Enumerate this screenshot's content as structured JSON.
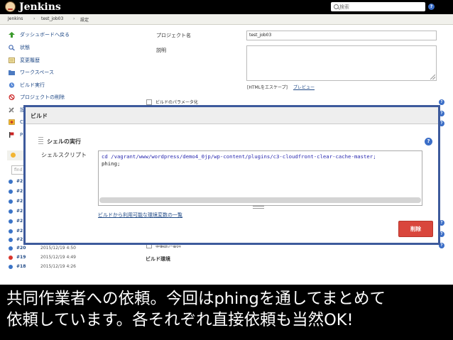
{
  "header": {
    "logo_text": "Jenkins",
    "search_placeholder": "検索",
    "help_label": "?"
  },
  "breadcrumb": [
    "Jenkins",
    "test_job03",
    "設定"
  ],
  "breadcrumb_separator": "›",
  "sidebar": {
    "items": [
      {
        "label": "ダッシュボードへ戻る",
        "icon": "up-arrow-icon"
      },
      {
        "label": "状態",
        "icon": "magnifier-icon"
      },
      {
        "label": "変更履歴",
        "icon": "notepad-icon"
      },
      {
        "label": "ワークスペース",
        "icon": "folder-icon"
      },
      {
        "label": "ビルド実行",
        "icon": "clock-icon"
      },
      {
        "label": "プロジェクトの削除",
        "icon": "no-entry-icon"
      }
    ],
    "partial_items": [
      "設",
      "C",
      "P"
    ],
    "search_partial": "find"
  },
  "build_history": [
    {
      "number": "#20",
      "date": "2015/12/19 4:50",
      "status": "blue"
    },
    {
      "number": "#19",
      "date": "2015/12/19 4:49",
      "status": "red"
    },
    {
      "number": "#18",
      "date": "2015/12/19 4:26",
      "status": "blue"
    }
  ],
  "build_history_partial": [
    "#2",
    "#2",
    "#2",
    "#2",
    "#2",
    "#2",
    "#2"
  ],
  "form": {
    "project_name_label": "プロジェクト名",
    "project_name_value": "test_job03",
    "description_label": "説明",
    "description_value": "",
    "html_escape_note": "[HTMLをエスケープ]",
    "preview_link": "プレビュー",
    "parameterize_label": "ビルドのパラメータ化",
    "periodic_partial": "定期的に実行",
    "build_env_label": "ビルド環境"
  },
  "build_dialog": {
    "title": "ビルド",
    "step_title": "シェルの実行",
    "shell_label": "シェルスクリプト",
    "code_lines": [
      "cd /vagrant/www/wordpress/demo4_0jp/wp-content/plugins/c3-cloudfront-clear-cache-master;",
      "phing;"
    ],
    "env_vars_link": "ビルドから利用可能な環境変数の一覧",
    "delete_button": "削除",
    "help_label": "?"
  },
  "caption": {
    "lines": [
      "共同作業者への依頼。今回はphingを通してまとめて",
      "依頼しています。各それぞれ直接依頼も当然OK!"
    ]
  },
  "colors": {
    "header_bg": "#000000",
    "dialog_border": "#3d5a9c",
    "delete_button": "#d9463c",
    "link": "#204a87",
    "status_blue": "#3b74c7",
    "status_red": "#d9362d"
  }
}
